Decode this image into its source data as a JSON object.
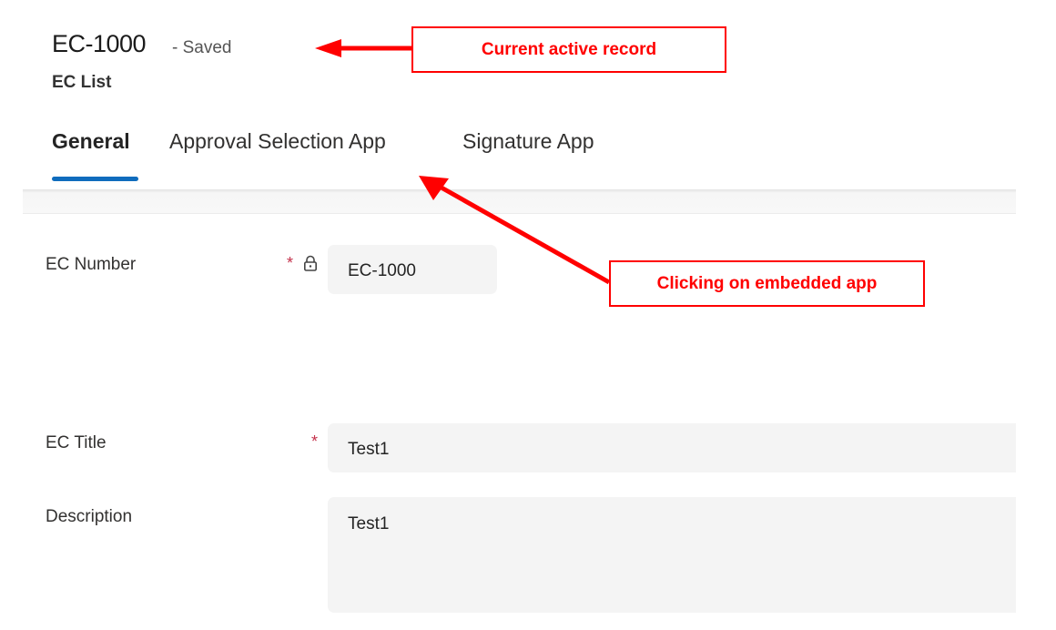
{
  "header": {
    "record_title": "EC-1000",
    "save_status": "- Saved",
    "entity_name": "EC List"
  },
  "tabs": [
    {
      "label": "General",
      "active": true
    },
    {
      "label": "Approval Selection App",
      "active": false
    },
    {
      "label": "Signature App",
      "active": false
    }
  ],
  "form": {
    "ec_number": {
      "label": "EC Number",
      "required_marker": "*",
      "locked": true,
      "value": "EC-1000"
    },
    "ec_title": {
      "label": "EC Title",
      "required_marker": "*",
      "value": "Test1"
    },
    "description": {
      "label": "Description",
      "value": "Test1"
    }
  },
  "annotations": {
    "current_record": "Current active record",
    "embedded_app": "Clicking on embedded app",
    "color": "#ff0000"
  },
  "colors": {
    "tab_underline": "#0f6cbd",
    "required": "#c4314b",
    "field_bg": "#f4f4f4"
  }
}
